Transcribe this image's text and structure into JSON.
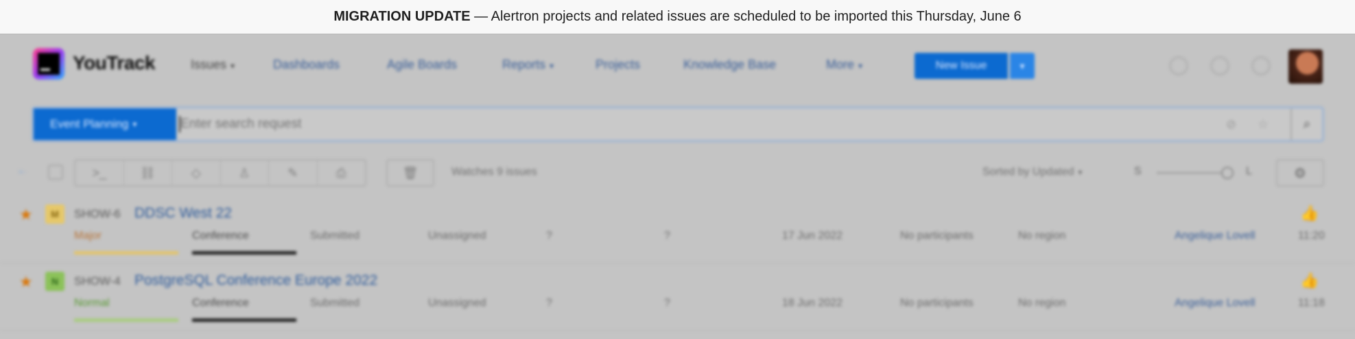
{
  "banner": {
    "strong": "MIGRATION UPDATE",
    "text": " — Alertron projects and related issues are scheduled to be imported this Thursday, June 6"
  },
  "header": {
    "logo_text": "YouTrack",
    "nav": [
      {
        "label": "Issues",
        "has_caret": true
      },
      {
        "label": "Dashboards"
      },
      {
        "label": "Agile Boards"
      },
      {
        "label": "Reports",
        "has_caret": true
      },
      {
        "label": "Projects"
      },
      {
        "label": "Knowledge Base"
      },
      {
        "label": "More",
        "has_caret": true
      }
    ],
    "new_issue_label": "New Issue",
    "icons": [
      "bell-icon",
      "help-icon",
      "settings-icon"
    ]
  },
  "search": {
    "context_label": "Event Planning",
    "placeholder": "Enter search request"
  },
  "toolbar": {
    "watches_text": "Watches 9 issues",
    "sort_label": "Sorted by Updated",
    "size_small": "S",
    "size_large": "L",
    "density_level": 0.87,
    "segment_icons": [
      "command-icon",
      "link-icon",
      "tag-icon",
      "assignee-icon",
      "edit-icon",
      "print-icon"
    ]
  },
  "issues": [
    {
      "id": "SHOW-6",
      "title": "DDSC West 22",
      "priority_letter": "M",
      "priority_label": "Major",
      "priority_color": "#e0a81a",
      "priority_text_color": "#b8753a",
      "type": "Conference",
      "state": "Submitted",
      "assignee": "Unassigned",
      "field_a": "?",
      "field_b": "?",
      "date": "17 Jun 2022",
      "participants": "No participants",
      "region": "No region",
      "reporter": "Angelique Lovell",
      "time": "11:20"
    },
    {
      "id": "SHOW-4",
      "title": "PostgreSQL Conference Europe 2022",
      "priority_letter": "N",
      "priority_label": "Normal",
      "priority_color": "#74b43c",
      "priority_text_color": "#5a9a35",
      "type": "Conference",
      "state": "Submitted",
      "assignee": "Unassigned",
      "field_a": "?",
      "field_b": "?",
      "date": "18 Jun 2022",
      "participants": "No participants",
      "region": "No region",
      "reporter": "Angelique Lovell",
      "time": "11:18"
    }
  ],
  "colors": {
    "accent": "#0c6ad0",
    "star": "#d8760a",
    "link": "#2f5c9c"
  }
}
